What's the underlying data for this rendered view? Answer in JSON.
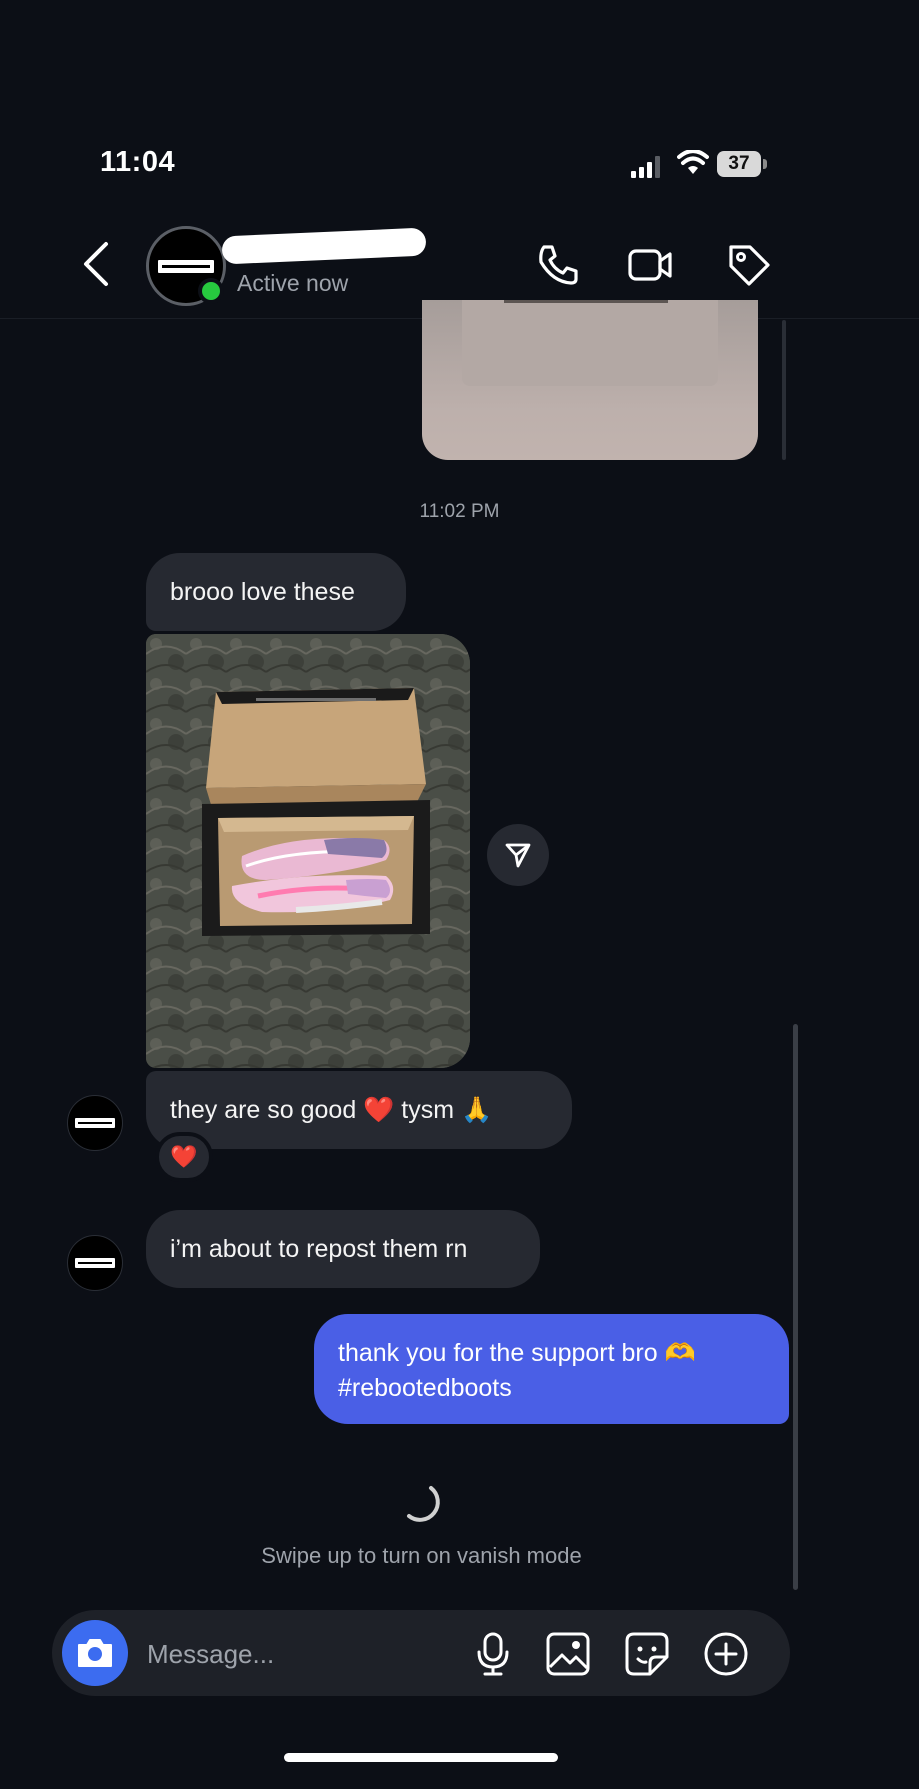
{
  "status_bar": {
    "time": "11:04",
    "battery": "37"
  },
  "header": {
    "contact_status": "Active now"
  },
  "thread": {
    "timestamp": "11:02 PM",
    "messages": [
      {
        "from": "them",
        "text": "brooo love these"
      },
      {
        "from": "them",
        "type": "photo",
        "description": "shoe box with pink boots"
      },
      {
        "from": "them",
        "text": "they are so good ❤️ tysm 🙏",
        "reaction": "❤️"
      },
      {
        "from": "them",
        "text": "i’m about to repost them rn"
      },
      {
        "from": "me",
        "line1": "thank you for the support bro 🫶",
        "line2": "#rebootedboots"
      }
    ],
    "vanish_hint": "Swipe up to turn on vanish mode"
  },
  "composer": {
    "placeholder": "Message..."
  },
  "colors": {
    "background": "#0c0f16",
    "incoming_bubble": "#262931",
    "outgoing_bubble": "#4a5fe6",
    "online": "#27c93f",
    "camera_button": "#3c6cf0"
  },
  "icons": [
    "back-chevron-icon",
    "phone-icon",
    "video-camera-icon",
    "tag-icon",
    "share-icon",
    "camera-icon",
    "microphone-icon",
    "gallery-icon",
    "sticker-icon",
    "plus-circle-icon"
  ]
}
